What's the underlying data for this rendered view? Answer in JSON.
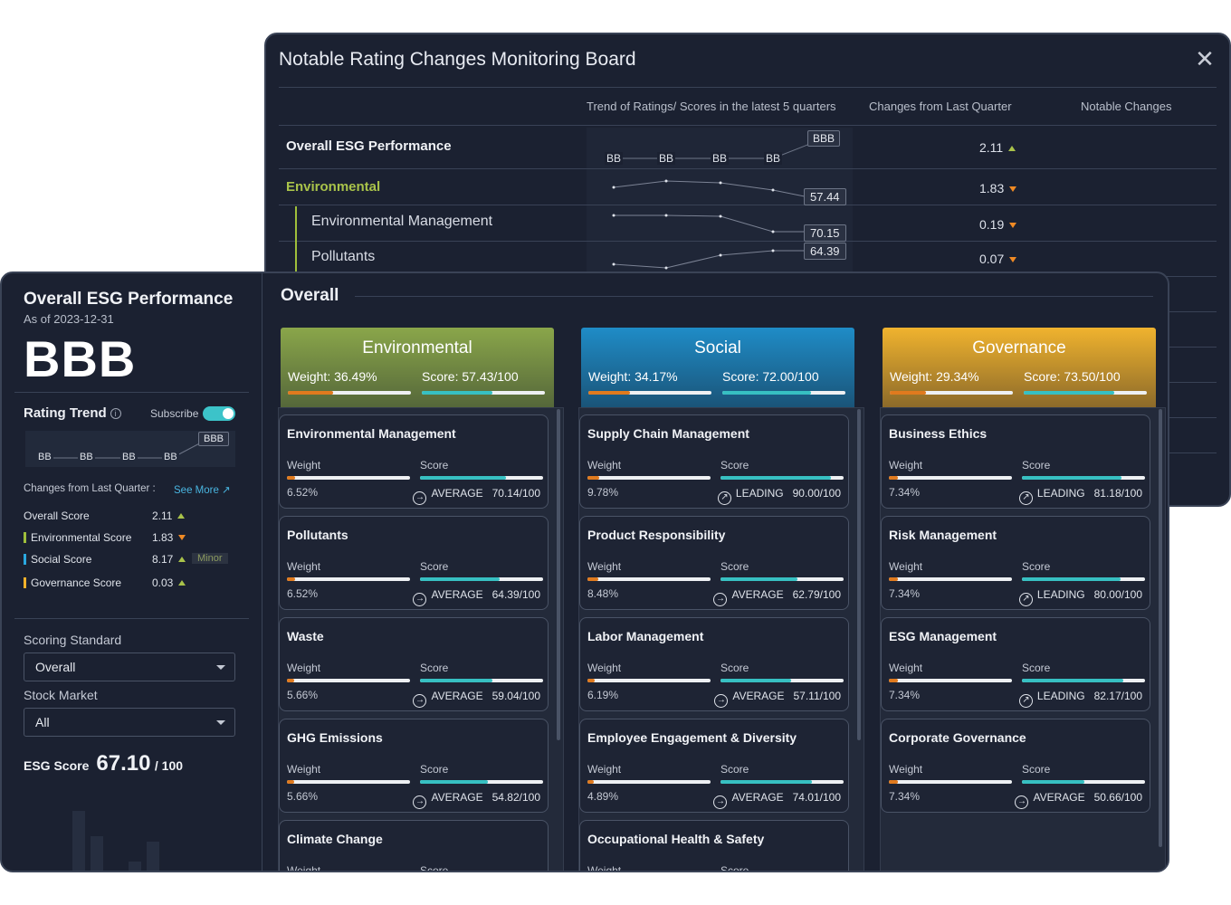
{
  "board": {
    "title": "Notable Rating Changes Monitoring Board",
    "columns": [
      "Trend of Ratings/ Scores in the latest 5 quarters",
      "Changes from Last Quarter",
      "Notable Changes"
    ],
    "rows": [
      {
        "label": "Overall ESG Performance",
        "change": "2.11",
        "dir": "up",
        "ratings": [
          "BB",
          "BB",
          "BB",
          "BB",
          "BBB"
        ]
      },
      {
        "label": "Environmental",
        "change": "1.83",
        "dir": "down",
        "latest": "57.44"
      },
      {
        "label": "Environmental Management",
        "change": "0.19",
        "dir": "down",
        "latest": "70.15"
      },
      {
        "label": "Pollutants",
        "change": "0.07",
        "dir": "down",
        "latest": "64.39"
      }
    ]
  },
  "sidebar": {
    "title": "Overall ESG Performance",
    "as_of": "As of 2023-12-31",
    "rating": "BBB",
    "rating_trend_label": "Rating Trend",
    "subscribe_label": "Subscribe",
    "trend_ratings": [
      "BB",
      "BB",
      "BB",
      "BB",
      "BBB"
    ],
    "changes_label": "Changes from Last Quarter :",
    "see_more": "See More ↗",
    "changes": [
      {
        "label": "Overall Score",
        "value": "2.11",
        "dir": "up",
        "color": ""
      },
      {
        "label": "Environmental Score",
        "value": "1.83",
        "dir": "down",
        "color": "#9fbf3b"
      },
      {
        "label": "Social Score",
        "value": "8.17",
        "dir": "up",
        "color": "#2aa8e0",
        "badge": "Minor"
      },
      {
        "label": "Governance Score",
        "value": "0.03",
        "dir": "up",
        "color": "#f3b22a"
      }
    ],
    "scoring_standard_label": "Scoring Standard",
    "scoring_standard_value": "Overall",
    "stock_market_label": "Stock Market",
    "stock_market_value": "All",
    "esg_score_label": "ESG Score",
    "esg_score_value": "67.10",
    "esg_score_denominator": "/ 100"
  },
  "content": {
    "title": "Overall",
    "pillars": [
      {
        "name": "Environmental",
        "weight_text": "Weight: 36.49%",
        "score_text": "Score: 57.43/100",
        "weight": 0.3649,
        "score": 0.5743,
        "color_top": "#8aa64a",
        "color_bottom": "#55673a",
        "cards": [
          {
            "title": "Environmental Management",
            "weight_label": "Weight",
            "score_label": "Score",
            "weight": "6.52%",
            "tier": "AVERAGE",
            "score": "70.14/100",
            "weight_frac": 0.0652,
            "score_frac": 0.7014
          },
          {
            "title": "Pollutants",
            "weight_label": "Weight",
            "score_label": "Score",
            "weight": "6.52%",
            "tier": "AVERAGE",
            "score": "64.39/100",
            "weight_frac": 0.0652,
            "score_frac": 0.6439
          },
          {
            "title": "Waste",
            "weight_label": "Weight",
            "score_label": "Score",
            "weight": "5.66%",
            "tier": "AVERAGE",
            "score": "59.04/100",
            "weight_frac": 0.0566,
            "score_frac": 0.5904
          },
          {
            "title": "GHG Emissions",
            "weight_label": "Weight",
            "score_label": "Score",
            "weight": "5.66%",
            "tier": "AVERAGE",
            "score": "54.82/100",
            "weight_frac": 0.0566,
            "score_frac": 0.5482
          },
          {
            "title": "Climate Change",
            "weight_label": "Weight",
            "score_label": "Score",
            "weight": "",
            "tier": "",
            "score": "",
            "weight_frac": 0,
            "score_frac": 0
          }
        ]
      },
      {
        "name": "Social",
        "weight_text": "Weight: 34.17%",
        "score_text": "Score: 72.00/100",
        "weight": 0.3417,
        "score": 0.72,
        "color_top": "#1f8cc7",
        "color_bottom": "#1a5478",
        "cards": [
          {
            "title": "Supply Chain Management",
            "weight_label": "Weight",
            "score_label": "Score",
            "weight": "9.78%",
            "tier": "LEADING",
            "score": "90.00/100",
            "weight_frac": 0.0978,
            "score_frac": 0.9
          },
          {
            "title": "Product Responsibility",
            "weight_label": "Weight",
            "score_label": "Score",
            "weight": "8.48%",
            "tier": "AVERAGE",
            "score": "62.79/100",
            "weight_frac": 0.0848,
            "score_frac": 0.6279
          },
          {
            "title": "Labor Management",
            "weight_label": "Weight",
            "score_label": "Score",
            "weight": "6.19%",
            "tier": "AVERAGE",
            "score": "57.11/100",
            "weight_frac": 0.0619,
            "score_frac": 0.5711
          },
          {
            "title": "Employee Engagement & Diversity",
            "weight_label": "Weight",
            "score_label": "Score",
            "weight": "4.89%",
            "tier": "AVERAGE",
            "score": "74.01/100",
            "weight_frac": 0.0489,
            "score_frac": 0.7401
          },
          {
            "title": "Occupational Health & Safety",
            "weight_label": "Weight",
            "score_label": "Score",
            "weight": "",
            "tier": "",
            "score": "",
            "weight_frac": 0,
            "score_frac": 0
          }
        ]
      },
      {
        "name": "Governance",
        "weight_text": "Weight: 29.34%",
        "score_text": "Score: 73.50/100",
        "weight": 0.2934,
        "score": 0.735,
        "color_top": "#f0b32e",
        "color_bottom": "#8c6a2a",
        "cards": [
          {
            "title": "Business Ethics",
            "weight_label": "Weight",
            "score_label": "Score",
            "weight": "7.34%",
            "tier": "LEADING",
            "score": "81.18/100",
            "weight_frac": 0.0734,
            "score_frac": 0.8118
          },
          {
            "title": "Risk Management",
            "weight_label": "Weight",
            "score_label": "Score",
            "weight": "7.34%",
            "tier": "LEADING",
            "score": "80.00/100",
            "weight_frac": 0.0734,
            "score_frac": 0.8
          },
          {
            "title": "ESG Management",
            "weight_label": "Weight",
            "score_label": "Score",
            "weight": "7.34%",
            "tier": "LEADING",
            "score": "82.17/100",
            "weight_frac": 0.0734,
            "score_frac": 0.8217
          },
          {
            "title": "Corporate Governance",
            "weight_label": "Weight",
            "score_label": "Score",
            "weight": "7.34%",
            "tier": "AVERAGE",
            "score": "50.66/100",
            "weight_frac": 0.0734,
            "score_frac": 0.5066
          }
        ]
      }
    ]
  },
  "colors": {
    "weight_bar": "#e07a1e",
    "score_bar": "#37c0c2",
    "up": "#a9c34a",
    "down": "#f08a24"
  }
}
